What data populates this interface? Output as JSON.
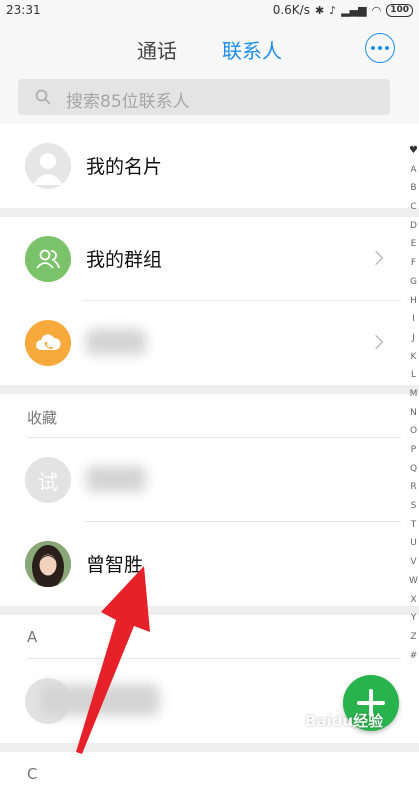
{
  "status_bar": {
    "time": "23:31",
    "net_speed": "0.6K/s",
    "battery": "100"
  },
  "header": {
    "tabs": [
      {
        "label": "通话",
        "active": false
      },
      {
        "label": "联系人",
        "active": true
      }
    ],
    "accent_color": "#1c8ff0"
  },
  "search": {
    "placeholder": "搜索85位联系人"
  },
  "my_card": {
    "label": "我的名片"
  },
  "groups": {
    "my_groups_label": "我的群组"
  },
  "favorites": {
    "header": "收藏",
    "items": [
      {
        "avatar_text": "试"
      },
      {
        "name": "曾智胜"
      }
    ]
  },
  "section_a": {
    "header": "A"
  },
  "section_next": {
    "header": "C"
  },
  "index_bar": {
    "letters": [
      "A",
      "B",
      "C",
      "D",
      "E",
      "F",
      "G",
      "H",
      "I",
      "J",
      "K",
      "L",
      "M",
      "N",
      "O",
      "P",
      "Q",
      "R",
      "S",
      "T",
      "U",
      "V",
      "W",
      "X",
      "Y",
      "Z",
      "#"
    ]
  },
  "watermark": "Baidu经验",
  "colors": {
    "fab": "#29b34d",
    "group_avatar": "#7ac36a",
    "cloud_avatar": "#f7a93b",
    "annotation_arrow": "#e62129"
  },
  "icons": {
    "search": "search-icon",
    "more": "more-icon",
    "add": "plus-icon"
  }
}
